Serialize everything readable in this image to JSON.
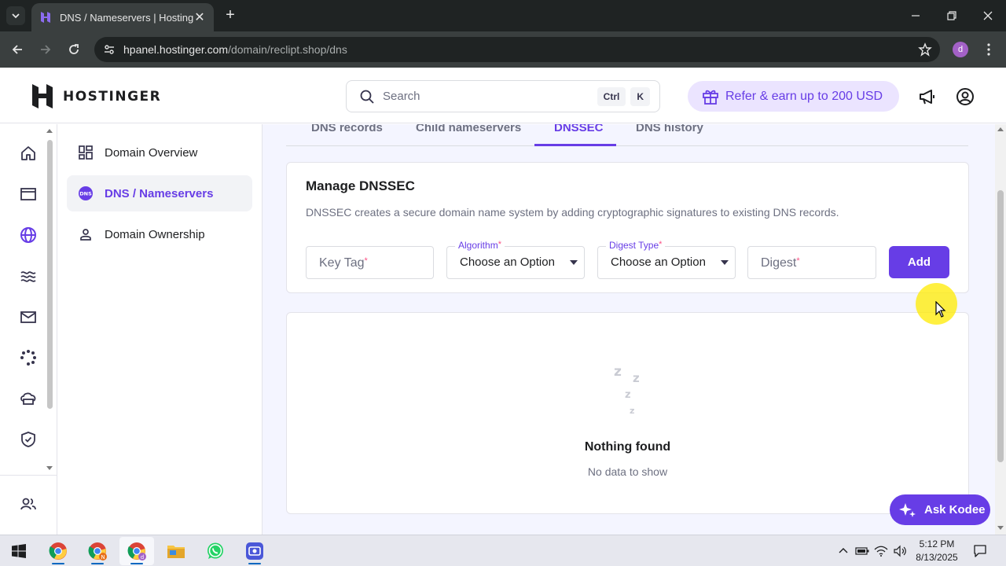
{
  "browser": {
    "tab_title": "DNS / Nameservers | Hostinger",
    "url_host": "hpanel.hostinger.com",
    "url_path": "/domain/reclipt.shop/dns",
    "profile_initial": "d"
  },
  "header": {
    "logo_text": "HOSTINGER",
    "search_placeholder": "Search",
    "shortcut_key_1": "Ctrl",
    "shortcut_key_2": "K",
    "refer_label": "Refer & earn up to 200 USD"
  },
  "subnav": {
    "items": [
      {
        "label": "Domain Overview"
      },
      {
        "label": "DNS / Nameservers"
      },
      {
        "label": "Domain Ownership"
      }
    ]
  },
  "tabs": [
    {
      "label": "DNS records"
    },
    {
      "label": "Child nameservers"
    },
    {
      "label": "DNSSEC"
    },
    {
      "label": "DNS history"
    }
  ],
  "dnssec": {
    "title": "Manage DNSSEC",
    "description": "DNSSEC creates a secure domain name system by adding cryptographic signatures to existing DNS records.",
    "key_tag_placeholder": "Key Tag",
    "algorithm_label": "Algorithm",
    "algorithm_value": "Choose an Option",
    "digest_type_label": "Digest Type",
    "digest_type_value": "Choose an Option",
    "digest_placeholder": "Digest",
    "required_mark": "*",
    "add_label": "Add"
  },
  "empty_state": {
    "title": "Nothing found",
    "subtitle": "No data to show"
  },
  "assistant": {
    "label": "Ask Kodee"
  },
  "taskbar": {
    "time": "5:12 PM",
    "date": "8/13/2025"
  },
  "colors": {
    "accent": "#673de6",
    "accent_light": "#ebe4ff",
    "required": "#fc5185",
    "main_bg": "#f4f5ff"
  }
}
